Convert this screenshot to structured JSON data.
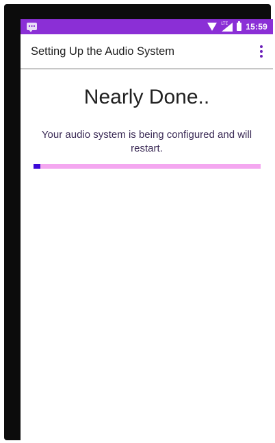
{
  "status_bar": {
    "time": "15:59",
    "network_label": "LTE",
    "icons": [
      "notification-icon",
      "wifi-icon",
      "signal-icon",
      "battery-icon"
    ]
  },
  "toolbar": {
    "title": "Setting Up the Audio System",
    "overflow_icon": "more-vert-icon"
  },
  "content": {
    "headline": "Nearly Done..",
    "message": "Your audio system is being configured and will restart.",
    "progress": 0.03
  },
  "colors": {
    "status_bar": "#8b2fd6",
    "accent": "#6a1fb8",
    "progress_track": "#f4a7f0",
    "progress_fill": "#3b09d8"
  }
}
